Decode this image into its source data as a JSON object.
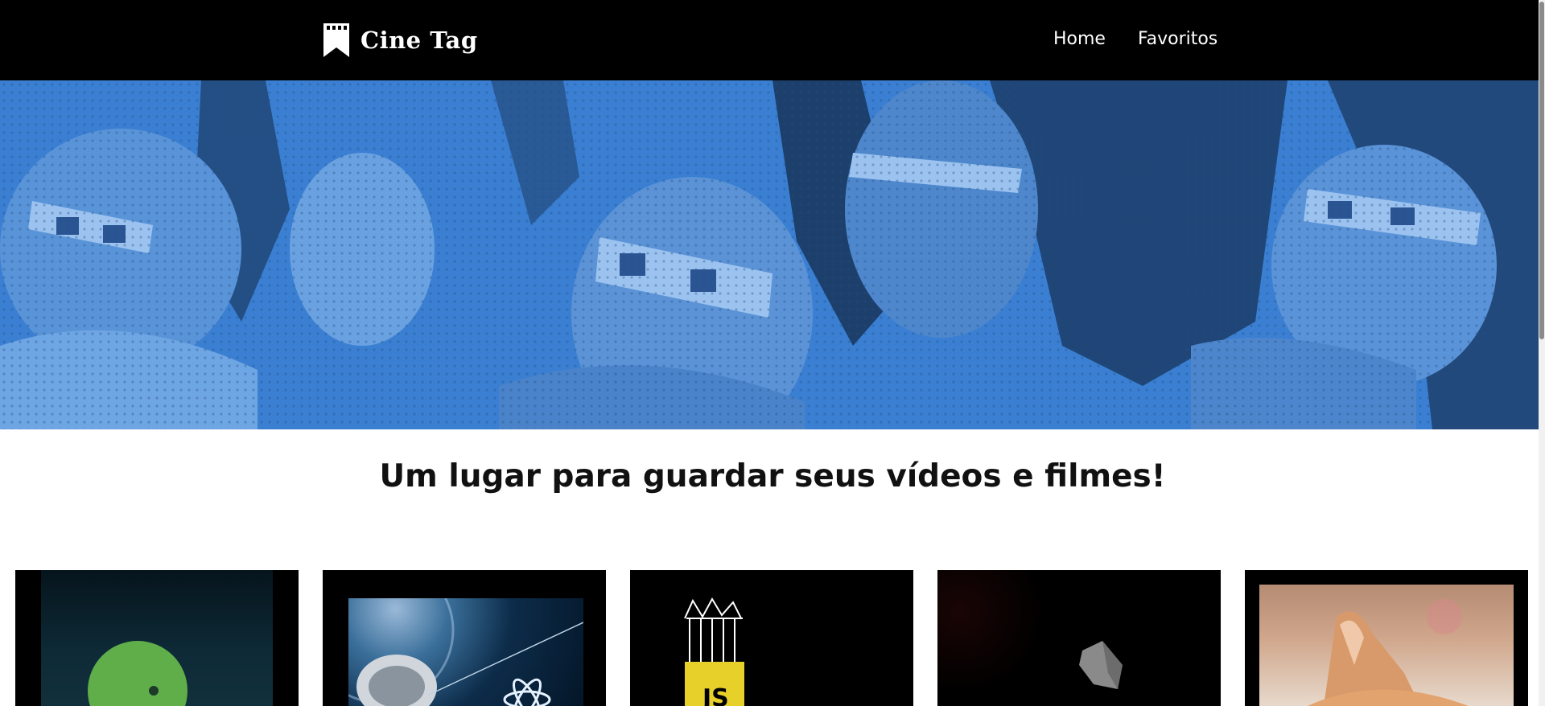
{
  "header": {
    "brand": "Cine Tag",
    "logo_icon": "bookmark-film-icon",
    "nav": [
      {
        "label": "Home"
      },
      {
        "label": "Favoritos"
      }
    ]
  },
  "hero": {
    "image": "audience-3d-glasses-banner",
    "tint_color": "#3b7fd2"
  },
  "tagline": "Um lugar para guardar seus vídeos e filmes!",
  "cards": [
    {
      "thumbnail": "android-robot-thumbnail"
    },
    {
      "thumbnail": "satellite-react-thumbnail"
    },
    {
      "thumbnail": "javascript-logo-thumbnail",
      "thumb_text": "JS"
    },
    {
      "thumbnail": "dart-logo-thumbnail"
    },
    {
      "thumbnail": "orange-cat-thumbnail"
    }
  ],
  "colors": {
    "header_bg": "#000000",
    "accent_blue": "#3b7fd2",
    "js_yellow": "#e8d02a"
  }
}
